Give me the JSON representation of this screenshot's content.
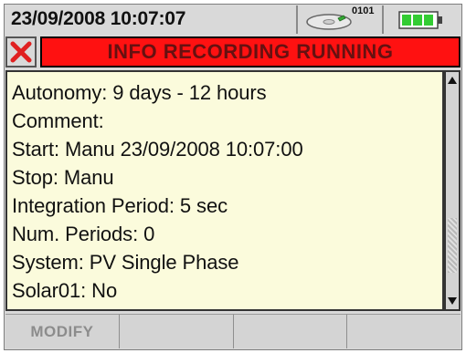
{
  "header": {
    "datetime": "23/09/2008 10:07:07",
    "media_counter": "0101",
    "media_icon": "memory-card-icon",
    "battery_icon": "battery-icon",
    "battery_color": "#33cc33"
  },
  "status": {
    "stop_icon": "close-icon",
    "stop_color": "#e02020",
    "text": "INFO RECORDING RUNNING",
    "background": "#ff1111"
  },
  "info": {
    "rows": [
      "Autonomy:  9 days - 12 hours",
      "Comment:",
      "Start:  Manu 23/09/2008 10:07:00",
      "Stop:  Manu",
      "Integration Period:  5 sec",
      "Num. Periods:  0",
      "System:  PV Single Phase",
      "Solar01: No"
    ]
  },
  "softkeys": [
    "MODIFY",
    "",
    "",
    ""
  ]
}
